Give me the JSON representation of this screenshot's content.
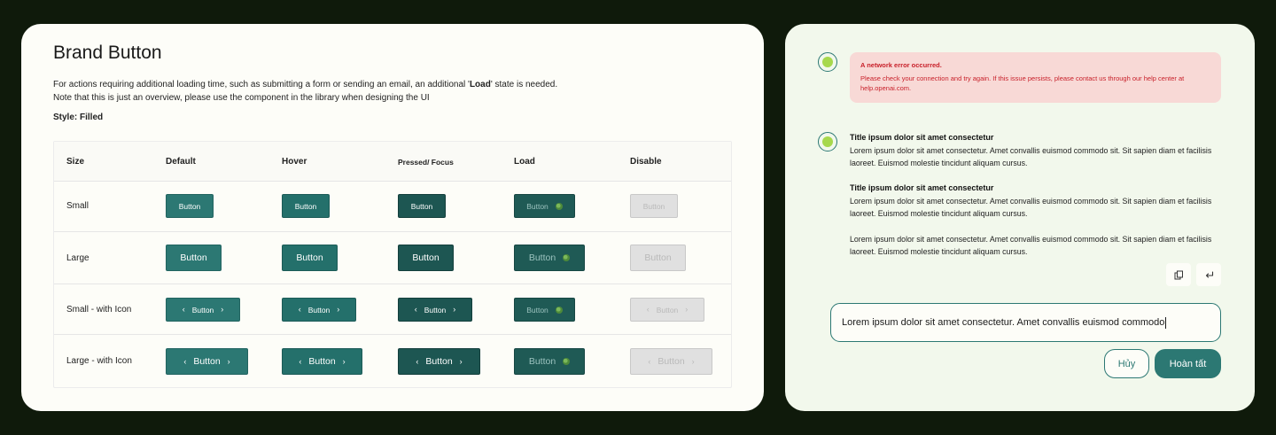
{
  "left": {
    "title": "Brand Button",
    "desc_part1": "For actions requiring additional loading time, such as submitting a form or sending an email,  an additional '",
    "desc_bold": "Load",
    "desc_part2": "' state is needed. Note that this is just an overview, please use the component in the library when designing the UI",
    "style_label": "Style: Filled",
    "headers": [
      "Size",
      "Default",
      "Hover",
      "Pressed/ Focus",
      "Load",
      "Disable"
    ],
    "rows": [
      "Small",
      "Large",
      "Small - with Icon",
      "Large - with Icon"
    ],
    "button_label": "Button",
    "colors": {
      "default": "#2c7873",
      "hover": "#24706b",
      "pressed": "#1d5652",
      "load": "#1f5a55",
      "disable": "#e0e0e0"
    }
  },
  "right": {
    "error": {
      "title": "A network error occurred.",
      "text": "Please check your connection and try again. If this issue persists, please contact us through our help center at help.openai.com."
    },
    "messages": [
      {
        "title": "Title ipsum dolor sit amet consectetur",
        "body": "Lorem ipsum dolor sit amet consectetur. Amet convallis euismod commodo sit. Sit sapien diam et facilisis laoreet. Euismod molestie tincidunt aliquam cursus."
      },
      {
        "title": "Title ipsum dolor sit amet consectetur",
        "body": "Lorem ipsum dolor sit amet consectetur. Amet convallis euismod commodo sit. Sit sapien diam et facilisis laoreet. Euismod molestie tincidunt aliquam cursus."
      },
      {
        "body": "Lorem ipsum dolor sit amet consectetur. Amet convallis euismod commodo sit. Sit sapien diam et facilisis laoreet. Euismod molestie tincidunt aliquam cursus."
      }
    ],
    "input_value": "Lorem ipsum dolor sit amet consectetur. Amet convallis euismod commodo",
    "cancel_label": "Hủy",
    "done_label": "Hoàn tất",
    "icons": {
      "copy": "copy-icon",
      "reply": "return-icon"
    }
  }
}
